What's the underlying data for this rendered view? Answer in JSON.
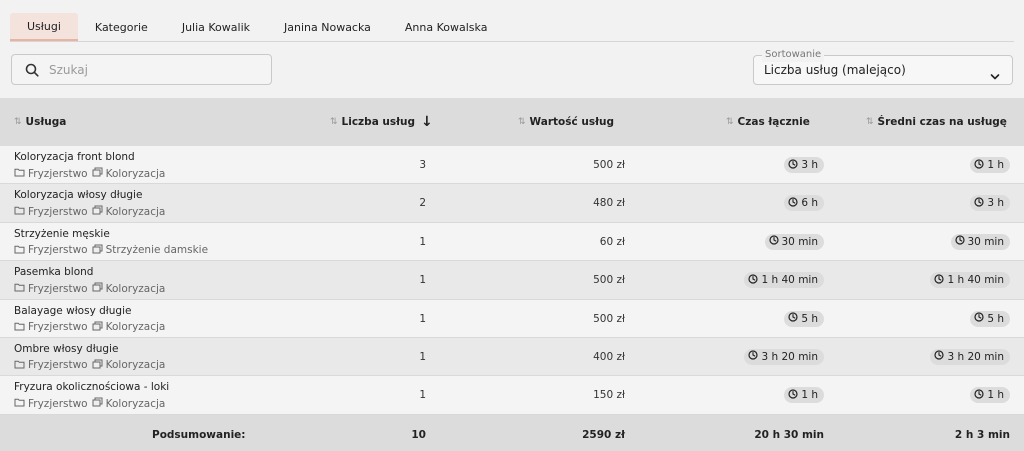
{
  "tabs": [
    "Usługi",
    "Kategorie",
    "Julia Kowalik",
    "Janina Nowacka",
    "Anna Kowalska"
  ],
  "search": {
    "placeholder": "Szukaj",
    "value": ""
  },
  "sort": {
    "label": "Sortowanie",
    "value": "Liczba usług (malejąco)"
  },
  "table": {
    "headers": {
      "service": "Usługa",
      "count": "Liczba usług",
      "value": "Wartość usług",
      "total_time": "Czas łącznie",
      "avg_time": "Średni czas na usługę"
    },
    "rows": [
      {
        "name": "Koloryzacja front blond",
        "category": "Fryzjerstwo",
        "subcategory": "Koloryzacja",
        "count": "3",
        "value": "500 zł",
        "total_time": "3 h",
        "avg_time": "1 h"
      },
      {
        "name": "Koloryzacja włosy długie",
        "category": "Fryzjerstwo",
        "subcategory": "Koloryzacja",
        "count": "2",
        "value": "480 zł",
        "total_time": "6 h",
        "avg_time": "3 h"
      },
      {
        "name": "Strzyżenie męskie",
        "category": "Fryzjerstwo",
        "subcategory": "Strzyżenie damskie",
        "count": "1",
        "value": "60 zł",
        "total_time": "30 min",
        "avg_time": "30 min"
      },
      {
        "name": "Pasemka blond",
        "category": "Fryzjerstwo",
        "subcategory": "Koloryzacja",
        "count": "1",
        "value": "500 zł",
        "total_time": "1 h 40 min",
        "avg_time": "1 h 40 min"
      },
      {
        "name": "Balayage włosy długie",
        "category": "Fryzjerstwo",
        "subcategory": "Koloryzacja",
        "count": "1",
        "value": "500 zł",
        "total_time": "5 h",
        "avg_time": "5 h"
      },
      {
        "name": "Ombre włosy długie",
        "category": "Fryzjerstwo",
        "subcategory": "Koloryzacja",
        "count": "1",
        "value": "400 zł",
        "total_time": "3 h 20 min",
        "avg_time": "3 h 20 min"
      },
      {
        "name": "Fryzura okolicznościowa - loki",
        "category": "Fryzjerstwo",
        "subcategory": "Koloryzacja",
        "count": "1",
        "value": "150 zł",
        "total_time": "1 h",
        "avg_time": "1 h"
      }
    ],
    "summary": {
      "label": "Podsumowanie:",
      "count": "10",
      "value": "2590 zł",
      "total_time": "20 h 30 min",
      "avg_time": "2 h 3 min"
    }
  },
  "colors": {
    "accent_tab_bg": "#f4e3dc",
    "accent_tab_border": "#e8b3a1",
    "header_bg": "#dcdcdc"
  }
}
